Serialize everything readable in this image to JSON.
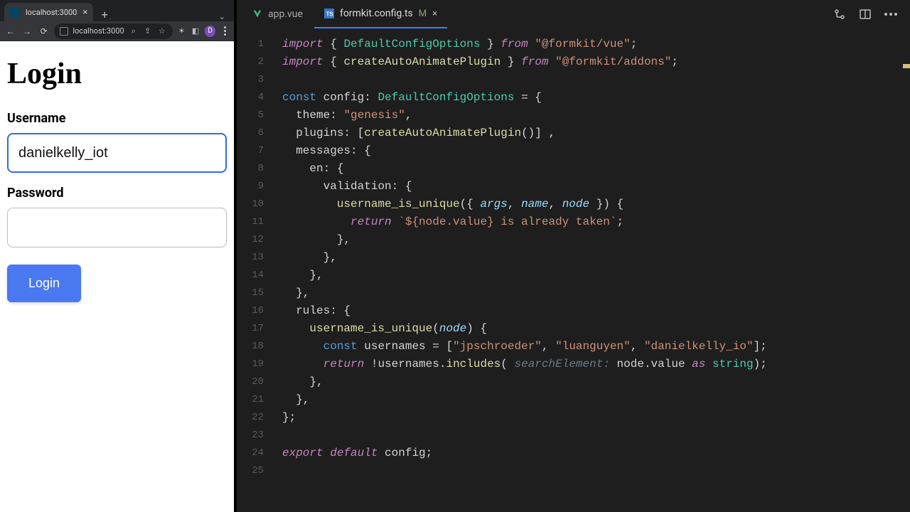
{
  "browser": {
    "tab_title": "localhost:3000",
    "address": "localhost:3000",
    "profile_initial": "D"
  },
  "page": {
    "heading": "Login",
    "username_label": "Username",
    "username_value": "danielkelly_iot",
    "password_label": "Password",
    "password_value": "",
    "login_button": "Login"
  },
  "editor": {
    "tabs": [
      {
        "name": "app.vue",
        "icon": "vue",
        "active": false,
        "modified": false
      },
      {
        "name": "formkit.config.ts",
        "icon": "ts",
        "active": true,
        "modified": true,
        "mod_indicator": "M"
      }
    ],
    "line_numbers": [
      "1",
      "2",
      "3",
      "4",
      "5",
      "6",
      "7",
      "8",
      "9",
      "10",
      "11",
      "12",
      "13",
      "14",
      "15",
      "16",
      "17",
      "18",
      "19",
      "20",
      "21",
      "22",
      "23",
      "24",
      "25"
    ],
    "code": {
      "imports": [
        {
          "named": "DefaultConfigOptions",
          "from": "@formkit/vue"
        },
        {
          "named": "createAutoAnimatePlugin",
          "from": "@formkit/addons"
        }
      ],
      "config_var": "config",
      "config_type": "DefaultConfigOptions",
      "theme": "genesis",
      "plugin_call": "createAutoAnimatePlugin",
      "messages_locale": "en",
      "validation_rule_name": "username_is_unique",
      "validation_args": [
        "args",
        "name",
        "node"
      ],
      "validation_return_template": "${node.value} is already taken",
      "rules_fn": "username_is_unique",
      "rules_param": "node",
      "usernames_var": "usernames",
      "usernames": [
        "jpschroeder",
        "luanguyen",
        "danielkelly_io"
      ],
      "hint_label": "searchElement:",
      "return_expr_tail": "node.value as string",
      "export_line": "export default config;"
    }
  }
}
